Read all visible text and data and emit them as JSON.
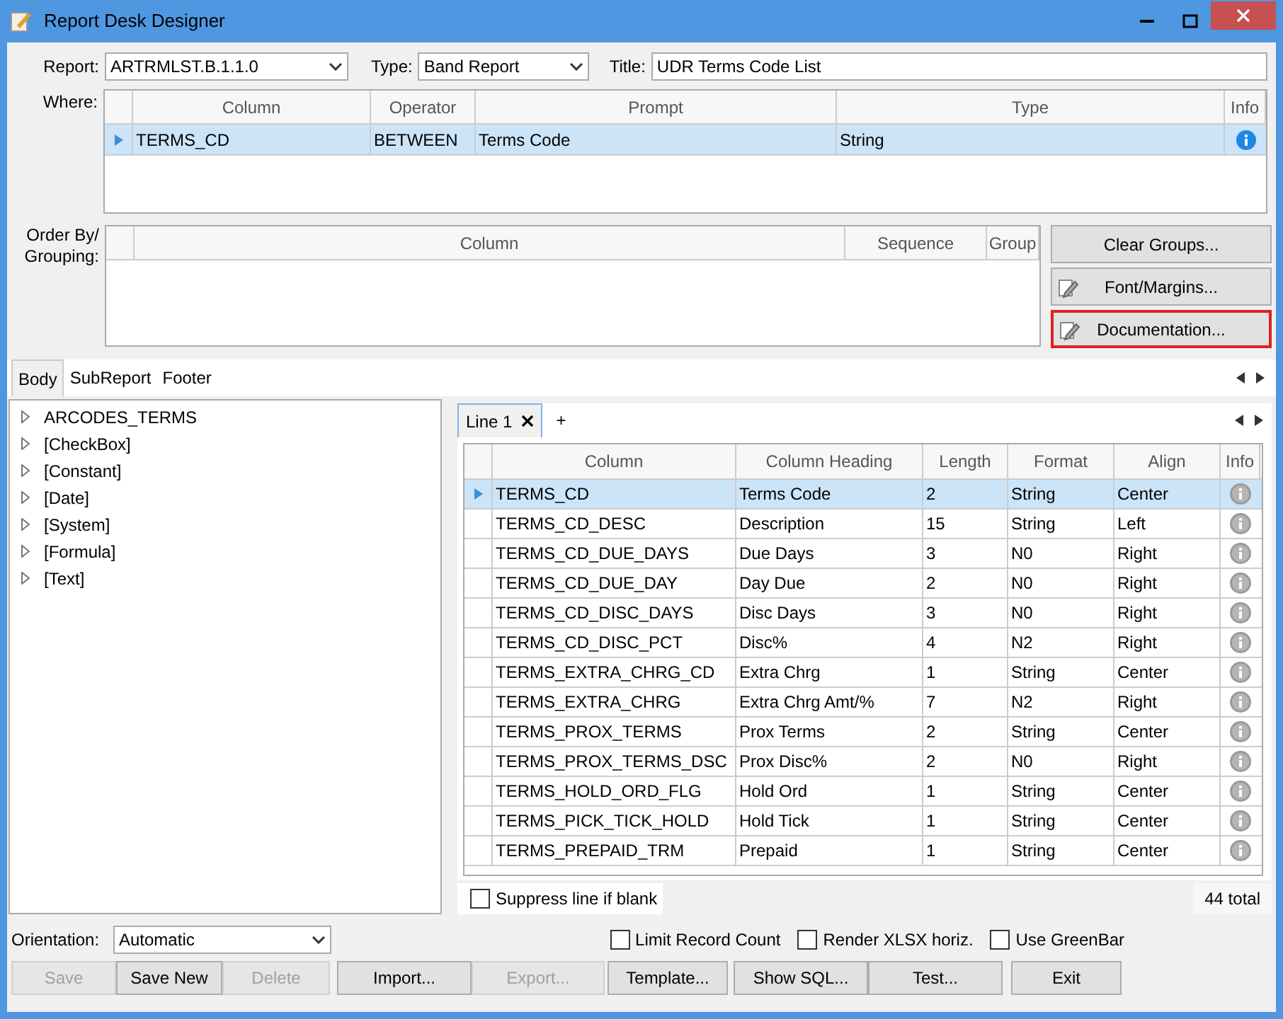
{
  "window": {
    "title": "Report Desk Designer"
  },
  "header": {
    "report_label": "Report:",
    "report_value": "ARTRMLST.B.1.1.0",
    "type_label": "Type:",
    "type_value": "Band Report",
    "title_label": "Title:",
    "title_value": "UDR Terms Code List"
  },
  "where": {
    "label": "Where:",
    "columns": [
      "Column",
      "Operator",
      "Prompt",
      "Type",
      "Info"
    ],
    "rows": [
      {
        "selected": true,
        "cells": [
          "TERMS_CD",
          "BETWEEN",
          "Terms Code",
          "String"
        ]
      }
    ]
  },
  "order_by": {
    "label": "Order By/ Grouping:",
    "columns": [
      "Column",
      "Sequence",
      "Group"
    ]
  },
  "side_buttons": [
    {
      "label": "Clear Groups...",
      "icon": false,
      "highlighted": false
    },
    {
      "label": "Font/Margins...",
      "icon": true,
      "highlighted": false
    },
    {
      "label": "Documentation...",
      "icon": true,
      "highlighted": true
    }
  ],
  "section_tabs": [
    {
      "label": "Body",
      "selected": true
    },
    {
      "label": "SubReport",
      "selected": false
    },
    {
      "label": "Footer",
      "selected": false
    }
  ],
  "tree": [
    "ARCODES_TERMS",
    "[CheckBox]",
    "[Constant]",
    "[Date]",
    "[System]",
    "[Formula]",
    "[Text]"
  ],
  "line_tabs": [
    {
      "label": "Line 1",
      "selected": true
    }
  ],
  "add_tab": "+",
  "fields": {
    "columns": [
      "Column",
      "Column Heading",
      "Length",
      "Format",
      "Align",
      "Info"
    ],
    "rows": [
      {
        "selected": true,
        "cells": [
          "TERMS_CD",
          "Terms Code",
          "2",
          "String",
          "Center"
        ]
      },
      {
        "selected": false,
        "cells": [
          "TERMS_CD_DESC",
          "Description",
          "15",
          "String",
          "Left"
        ]
      },
      {
        "selected": false,
        "cells": [
          "TERMS_CD_DUE_DAYS",
          "Due Days",
          "3",
          "N0",
          "Right"
        ]
      },
      {
        "selected": false,
        "cells": [
          "TERMS_CD_DUE_DAY",
          "Day Due",
          "2",
          "N0",
          "Right"
        ]
      },
      {
        "selected": false,
        "cells": [
          "TERMS_CD_DISC_DAYS",
          "Disc Days",
          "3",
          "N0",
          "Right"
        ]
      },
      {
        "selected": false,
        "cells": [
          "TERMS_CD_DISC_PCT",
          "Disc%",
          "4",
          "N2",
          "Right"
        ]
      },
      {
        "selected": false,
        "cells": [
          "TERMS_EXTRA_CHRG_CD",
          "Extra Chrg",
          "1",
          "String",
          "Center"
        ]
      },
      {
        "selected": false,
        "cells": [
          "TERMS_EXTRA_CHRG",
          "Extra Chrg Amt/%",
          "7",
          "N2",
          "Right"
        ]
      },
      {
        "selected": false,
        "cells": [
          "TERMS_PROX_TERMS",
          "Prox Terms",
          "2",
          "String",
          "Center"
        ]
      },
      {
        "selected": false,
        "cells": [
          "TERMS_PROX_TERMS_DSC",
          "Prox Disc%",
          "2",
          "N0",
          "Right"
        ]
      },
      {
        "selected": false,
        "cells": [
          "TERMS_HOLD_ORD_FLG",
          "Hold Ord",
          "1",
          "String",
          "Center"
        ]
      },
      {
        "selected": false,
        "cells": [
          "TERMS_PICK_TICK_HOLD",
          "Hold Tick",
          "1",
          "String",
          "Center"
        ]
      },
      {
        "selected": false,
        "cells": [
          "TERMS_PREPAID_TRM",
          "Prepaid",
          "1",
          "String",
          "Center"
        ]
      }
    ]
  },
  "suppress": {
    "label": "Suppress line if blank",
    "checked": false
  },
  "total": "44 total",
  "orientation": {
    "label": "Orientation:",
    "value": "Automatic"
  },
  "options": [
    {
      "label": "Limit Record Count",
      "checked": false
    },
    {
      "label": "Render XLSX horiz.",
      "checked": false
    },
    {
      "label": "Use GreenBar",
      "checked": false
    }
  ],
  "buttons": [
    {
      "label": "Save",
      "disabled": true
    },
    {
      "label": "Save New",
      "disabled": false
    },
    {
      "label": "Delete",
      "disabled": true
    },
    {
      "label": "Import...",
      "disabled": false
    },
    {
      "label": "Export...",
      "disabled": true
    },
    {
      "label": "Template...",
      "disabled": false
    },
    {
      "label": "Show SQL...",
      "disabled": false
    },
    {
      "label": "Test...",
      "disabled": false
    },
    {
      "label": "Exit",
      "disabled": false
    }
  ]
}
